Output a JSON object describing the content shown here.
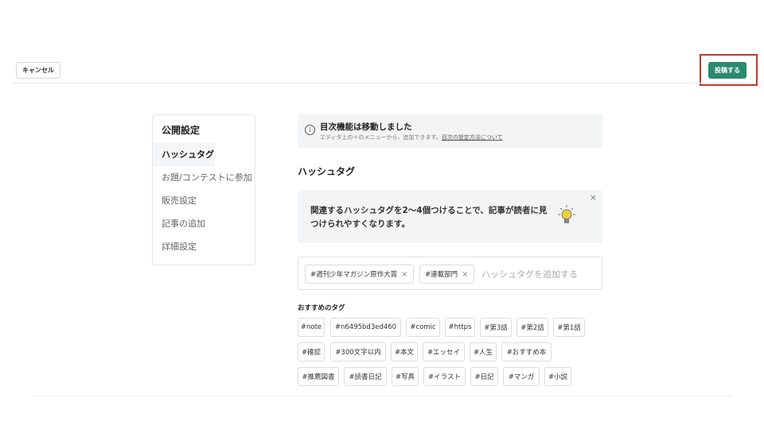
{
  "header": {
    "cancel_label": "キャンセル",
    "publish_label": "投稿する",
    "publish_color": "#2b8a6e",
    "highlight_color": "#c0392b"
  },
  "sidebar": {
    "title": "公開設定",
    "items": [
      {
        "label": "ハッシュタグ",
        "active": true
      },
      {
        "label": "お題/コンテストに参加",
        "active": false
      },
      {
        "label": "販売設定",
        "active": false
      },
      {
        "label": "記事の追加",
        "active": false
      },
      {
        "label": "詳細設定",
        "active": false
      }
    ]
  },
  "notice": {
    "icon": "info-icon",
    "title": "目次機能は移動しました",
    "subtitle": "エディタ上の＋のメニューから、追加できます。",
    "link": "目次の設定方法について"
  },
  "hashtag_section": {
    "title": "ハッシュタグ",
    "tip_text": "関連するハッシュタグを2〜4個つけることで、記事が読者に見つけられやすくなります。",
    "tip_icon": "lightbulb-icon",
    "close_glyph": "×",
    "selected_tags": [
      "#週刊少年マガジン原作大賞",
      "#連載部門"
    ],
    "remove_glyph": "×",
    "input_placeholder": "ハッシュタグを追加する"
  },
  "recommended": {
    "title": "おすすめのタグ",
    "rows": [
      [
        "#note",
        "#n6495bd3ed460",
        "#comic",
        "#https",
        "#第3話",
        "#第2話",
        "#第1話"
      ],
      [
        "#確認",
        "#300文字以内",
        "#本文",
        "#エッセイ",
        "#人生",
        "#おすすめ本"
      ],
      [
        "#推薦図書",
        "#読書日記",
        "#写真",
        "#イラスト",
        "#日記",
        "#マンガ",
        "#小説"
      ]
    ]
  }
}
